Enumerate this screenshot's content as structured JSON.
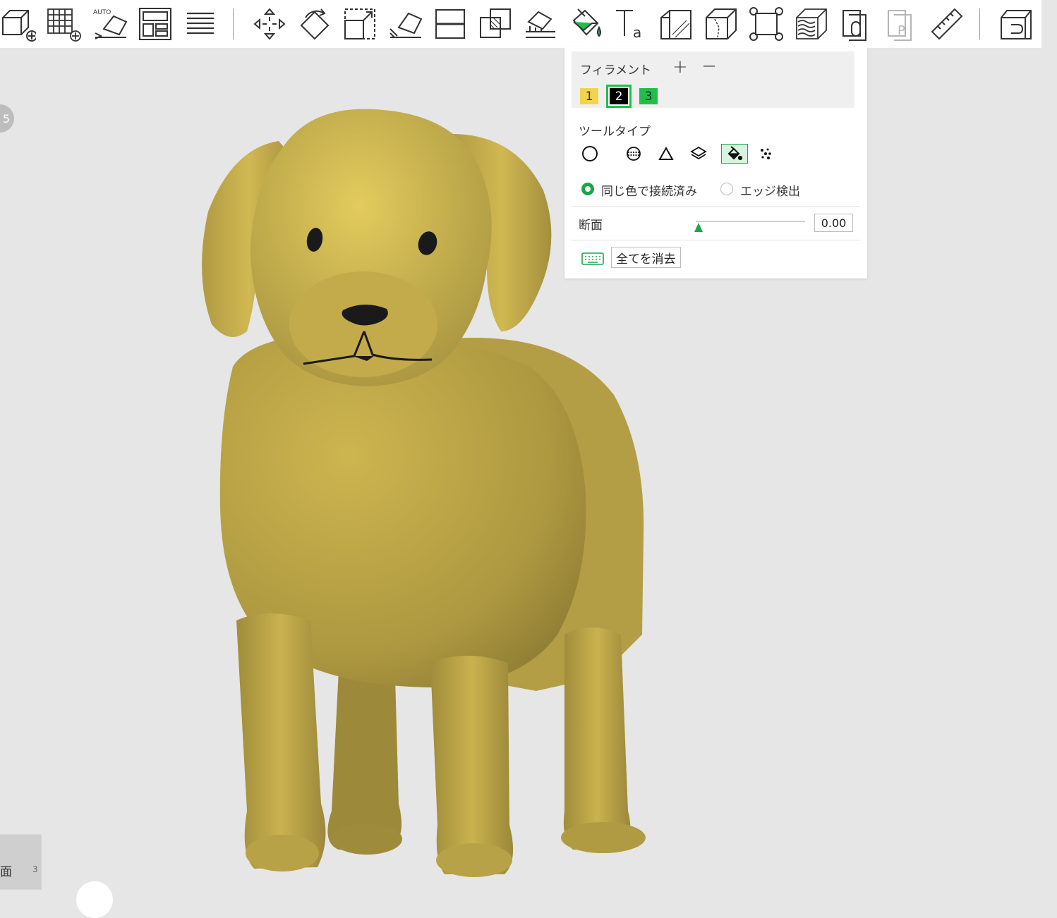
{
  "toolbar": {
    "tools": [
      {
        "name": "add-object"
      },
      {
        "name": "add-plate"
      },
      {
        "name": "auto-orient"
      },
      {
        "name": "arrange"
      },
      {
        "name": "layers"
      },
      {
        "name": "move"
      },
      {
        "name": "rotate"
      },
      {
        "name": "scale"
      },
      {
        "name": "lay-on-face"
      },
      {
        "name": "cut"
      },
      {
        "name": "boolean"
      },
      {
        "name": "support-paint"
      },
      {
        "name": "color-paint"
      },
      {
        "name": "text"
      },
      {
        "name": "emboss"
      },
      {
        "name": "seam"
      },
      {
        "name": "fuzzy"
      },
      {
        "name": "variable-layer"
      },
      {
        "name": "assembly"
      },
      {
        "name": "placeholder"
      },
      {
        "name": "measure"
      },
      {
        "name": "assembly-view"
      }
    ],
    "auto_label": "AUTO"
  },
  "viewport": {
    "corner_label": "5"
  },
  "bottom_tab": {
    "label": "面",
    "label2": "3"
  },
  "panel": {
    "filament_label": "フィラメント",
    "add_symbol": "+",
    "remove_symbol": "—",
    "filaments": [
      {
        "label": "1",
        "color": "#f2d34f",
        "text_color": "#333333"
      },
      {
        "label": "2",
        "color": "#000000",
        "text_color": "#ffffff",
        "selected": true
      },
      {
        "label": "3",
        "color": "#1fbf4a",
        "text_color": "#222222"
      }
    ],
    "tool_type_label": "ツールタイプ",
    "tools": [
      {
        "name": "circle"
      },
      {
        "name": "sphere"
      },
      {
        "name": "triangle"
      },
      {
        "name": "height-range"
      },
      {
        "name": "fill",
        "selected": true
      },
      {
        "name": "gap-fill"
      }
    ],
    "radio_options": [
      {
        "label": "同じ色で接続済み",
        "checked": true
      },
      {
        "label": "エッジ検出",
        "checked": false
      }
    ],
    "section_label": "断面",
    "section_value": "0.00",
    "section_fraction": 0.0,
    "clear_all_label": "全てを消去",
    "accent_color": "#1aa64a"
  },
  "model": {
    "body_color": "#c9b24e",
    "feature_color": "#1a1a1a"
  }
}
